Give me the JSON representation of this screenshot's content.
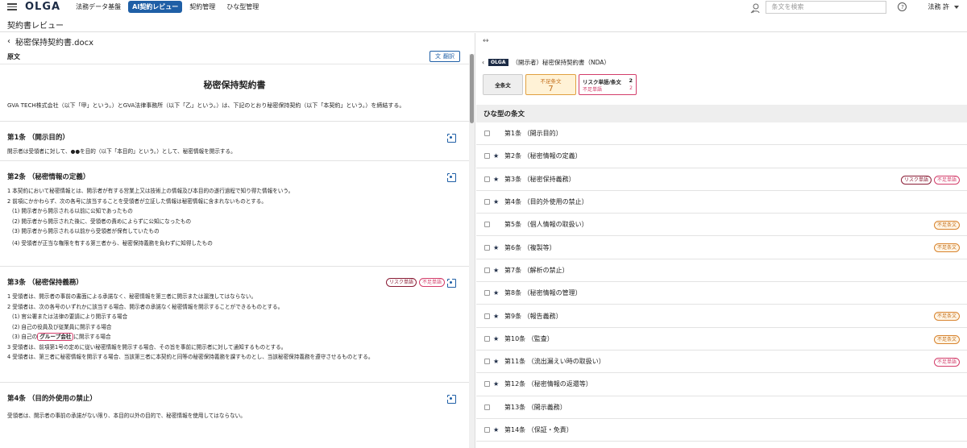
{
  "header": {
    "logo": "OLGA",
    "nav": [
      "法務データ基盤",
      "AI契約レビュー",
      "契約管理",
      "ひな型管理"
    ],
    "active_index": 1,
    "search_placeholder": "条文を検索",
    "help": "?",
    "user": "法務 許"
  },
  "page": {
    "title": "契約書レビュー"
  },
  "left": {
    "file_name": "秘密保持契約書.docx",
    "original_label": "原文",
    "translate_label": "翻訳",
    "doc_title": "秘密保持契約書",
    "preamble": "GVA TECH株式会社（以下「甲」という。）とGVA法律事務所（以下「乙」という。）は、下記のとおり秘密保持契約（以下「本契約」という。）を締結する。",
    "sections": [
      {
        "title": "第1条 （開示目的）",
        "tags": [],
        "lines": [
          {
            "t": "開示者は受領者に対して、●●を目的（以下「本目的」という。）として、秘密情報を開示する。",
            "ind": false
          }
        ]
      },
      {
        "title": "第2条 （秘密情報の定義）",
        "tags": [],
        "lines": [
          {
            "t": "1 本契約において秘密情報とは、開示者が有する営業上又は技術上の情報及び本目的の遂行過程で知り得た情報をいう。",
            "ind": false
          },
          {
            "t": "2 前項にかかわらず、次の各号に該当することを受領者が立証した情報は秘密情報に含まれないものとする。",
            "ind": false
          },
          {
            "t": "(1) 開示者から開示される以前に公知であったもの",
            "ind": true
          },
          {
            "t": "(2) 開示者から開示された後に、受領者の責めによらずに公知になったもの",
            "ind": true
          },
          {
            "t": "(3) 開示者から開示される以前から受領者が保有していたもの",
            "ind": true
          },
          {
            "t": "(4) 受領者が正当な権限を有する第三者から、秘密保持義務を負わずに知得したもの",
            "ind": true
          }
        ]
      },
      {
        "title": "第3条 （秘密保持義務）",
        "tags": [
          "リスク単語",
          "不足単語"
        ],
        "lines": [
          {
            "t": "1 受領者は、開示者の事前の書面による承諾なく、秘密情報を第三者に開示または漏洩してはならない。",
            "ind": false
          },
          {
            "t": "2 受領者は、次の各号のいずれかに該当する場合、開示者の承諾なく秘密情報を開示することができるものとする。",
            "ind": false
          },
          {
            "t": "(1) 官公署または法律の要請により開示する場合",
            "ind": true
          },
          {
            "t": "(2) 自己の役員及び従業員に開示する場合",
            "ind": true
          },
          {
            "t": "3 受領者は、前項第1号の定めに従い秘密情報を開示する場合、その旨を事前に開示者に対して通知するものとする。",
            "ind": false
          },
          {
            "t": "4 受領者は、第三者に秘密情報を開示する場合、当該第三者に本契約と同等の秘密保持義務を課すものとし、当該秘密保持義務を遵守させるものとする。",
            "ind": false
          }
        ],
        "hl_line": {
          "pre": "(3) 自己の",
          "hl": "グループ会社",
          "post": "に開示する場合"
        }
      },
      {
        "title": "第4条 （目的外使用の禁止）",
        "tags": [],
        "lines": [
          {
            "t": "受領者は、開示者の事前の承諾がない限り、本目的以外の目的で、秘密情報を使用してはならない。",
            "ind": false
          }
        ]
      }
    ]
  },
  "right": {
    "badge": "OLGA",
    "contract_title": "（開示者）秘密保持契約書（NDA）",
    "tab_all": "全条文",
    "tab_lack_label": "不足条文",
    "tab_lack_count": "7",
    "tab_risk_label": "リスク単語/条文",
    "tab_risk_count": "2",
    "tab_short_label": "不足単語",
    "tab_short_count": "2",
    "list_header": "ひな型の条文",
    "clauses": [
      {
        "label": "第1条 （開示目的）",
        "star": false,
        "tags": []
      },
      {
        "label": "第2条 （秘密情報の定義）",
        "star": true,
        "tags": []
      },
      {
        "label": "第3条 （秘密保持義務）",
        "star": true,
        "tags": [
          "リスク単語",
          "不足単語"
        ]
      },
      {
        "label": "第4条 （目的外使用の禁止）",
        "star": true,
        "tags": []
      },
      {
        "label": "第5条 （個人情報の取扱い）",
        "star": false,
        "tags": [
          "不足条文"
        ]
      },
      {
        "label": "第6条 （複製等）",
        "star": true,
        "tags": [
          "不足条文"
        ]
      },
      {
        "label": "第7条 （解析の禁止）",
        "star": true,
        "tags": []
      },
      {
        "label": "第8条 （秘密情報の管理）",
        "star": true,
        "tags": []
      },
      {
        "label": "第9条 （報告義務）",
        "star": true,
        "tags": [
          "不足条文"
        ]
      },
      {
        "label": "第10条 （監査）",
        "star": true,
        "tags": [
          "不足条文"
        ]
      },
      {
        "label": "第11条 （流出漏えい時の取扱い）",
        "star": true,
        "tags": [
          "不足単語"
        ]
      },
      {
        "label": "第12条 （秘密情報の返還等）",
        "star": true,
        "tags": []
      },
      {
        "label": "第13条 （開示義務）",
        "star": false,
        "tags": []
      },
      {
        "label": "第14条 （保証・免責）",
        "star": true,
        "tags": []
      }
    ]
  }
}
